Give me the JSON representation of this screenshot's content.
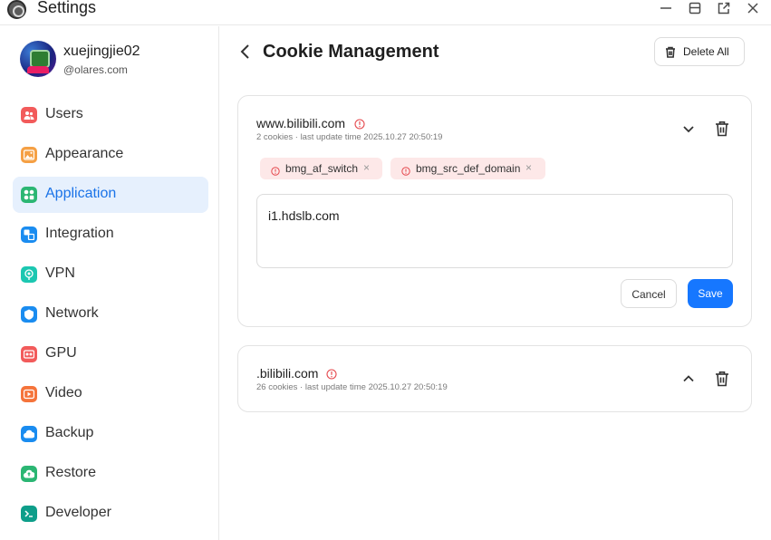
{
  "app": {
    "title": "Settings"
  },
  "window_controls": [
    "minimize-icon",
    "restore-icon",
    "popout-icon",
    "close-icon"
  ],
  "profile": {
    "username": "xuejingjie02",
    "domain": "@olares.com"
  },
  "sidebar": {
    "items": [
      {
        "label": "Users",
        "icon": "users-icon",
        "color": "#f25b5b",
        "active": false
      },
      {
        "label": "Appearance",
        "icon": "appearance-icon",
        "color": "#f5a044",
        "active": false
      },
      {
        "label": "Application",
        "icon": "application-icon",
        "color": "#2bb673",
        "active": true
      },
      {
        "label": "Integration",
        "icon": "integration-icon",
        "color": "#1a8cf0",
        "active": false
      },
      {
        "label": "VPN",
        "icon": "vpn-icon",
        "color": "#1cc7b1",
        "active": false
      },
      {
        "label": "Network",
        "icon": "network-icon",
        "color": "#1a8cf0",
        "active": false
      },
      {
        "label": "GPU",
        "icon": "gpu-icon",
        "color": "#f25b5b",
        "active": false
      },
      {
        "label": "Video",
        "icon": "video-icon",
        "color": "#f5743b",
        "active": false
      },
      {
        "label": "Backup",
        "icon": "backup-icon",
        "color": "#1a8cf0",
        "active": false
      },
      {
        "label": "Restore",
        "icon": "restore-icon",
        "color": "#2bb673",
        "active": false
      },
      {
        "label": "Developer",
        "icon": "developer-icon",
        "color": "#0e9e8a",
        "active": false
      }
    ]
  },
  "header": {
    "title": "Cookie Management",
    "delete_all_label": "Delete All"
  },
  "cookies": [
    {
      "domain": "www.bilibili.com",
      "meta": "2 cookies · last update time 2025.10.27 20:50:19",
      "expanded": true,
      "chips": [
        "bmg_af_switch",
        "bmg_src_def_domain"
      ],
      "value": "i1.hdslb.com",
      "cancel_label": "Cancel",
      "save_label": "Save"
    },
    {
      "domain": ".bilibili.com",
      "meta": "26 cookies · last update time 2025.10.27 20:50:19",
      "expanded": false
    }
  ],
  "colors": {
    "accent": "#1677ff",
    "warning": "#e5484d",
    "chip_bg": "#fde8e8",
    "active_nav_bg": "#e6f0fd"
  }
}
